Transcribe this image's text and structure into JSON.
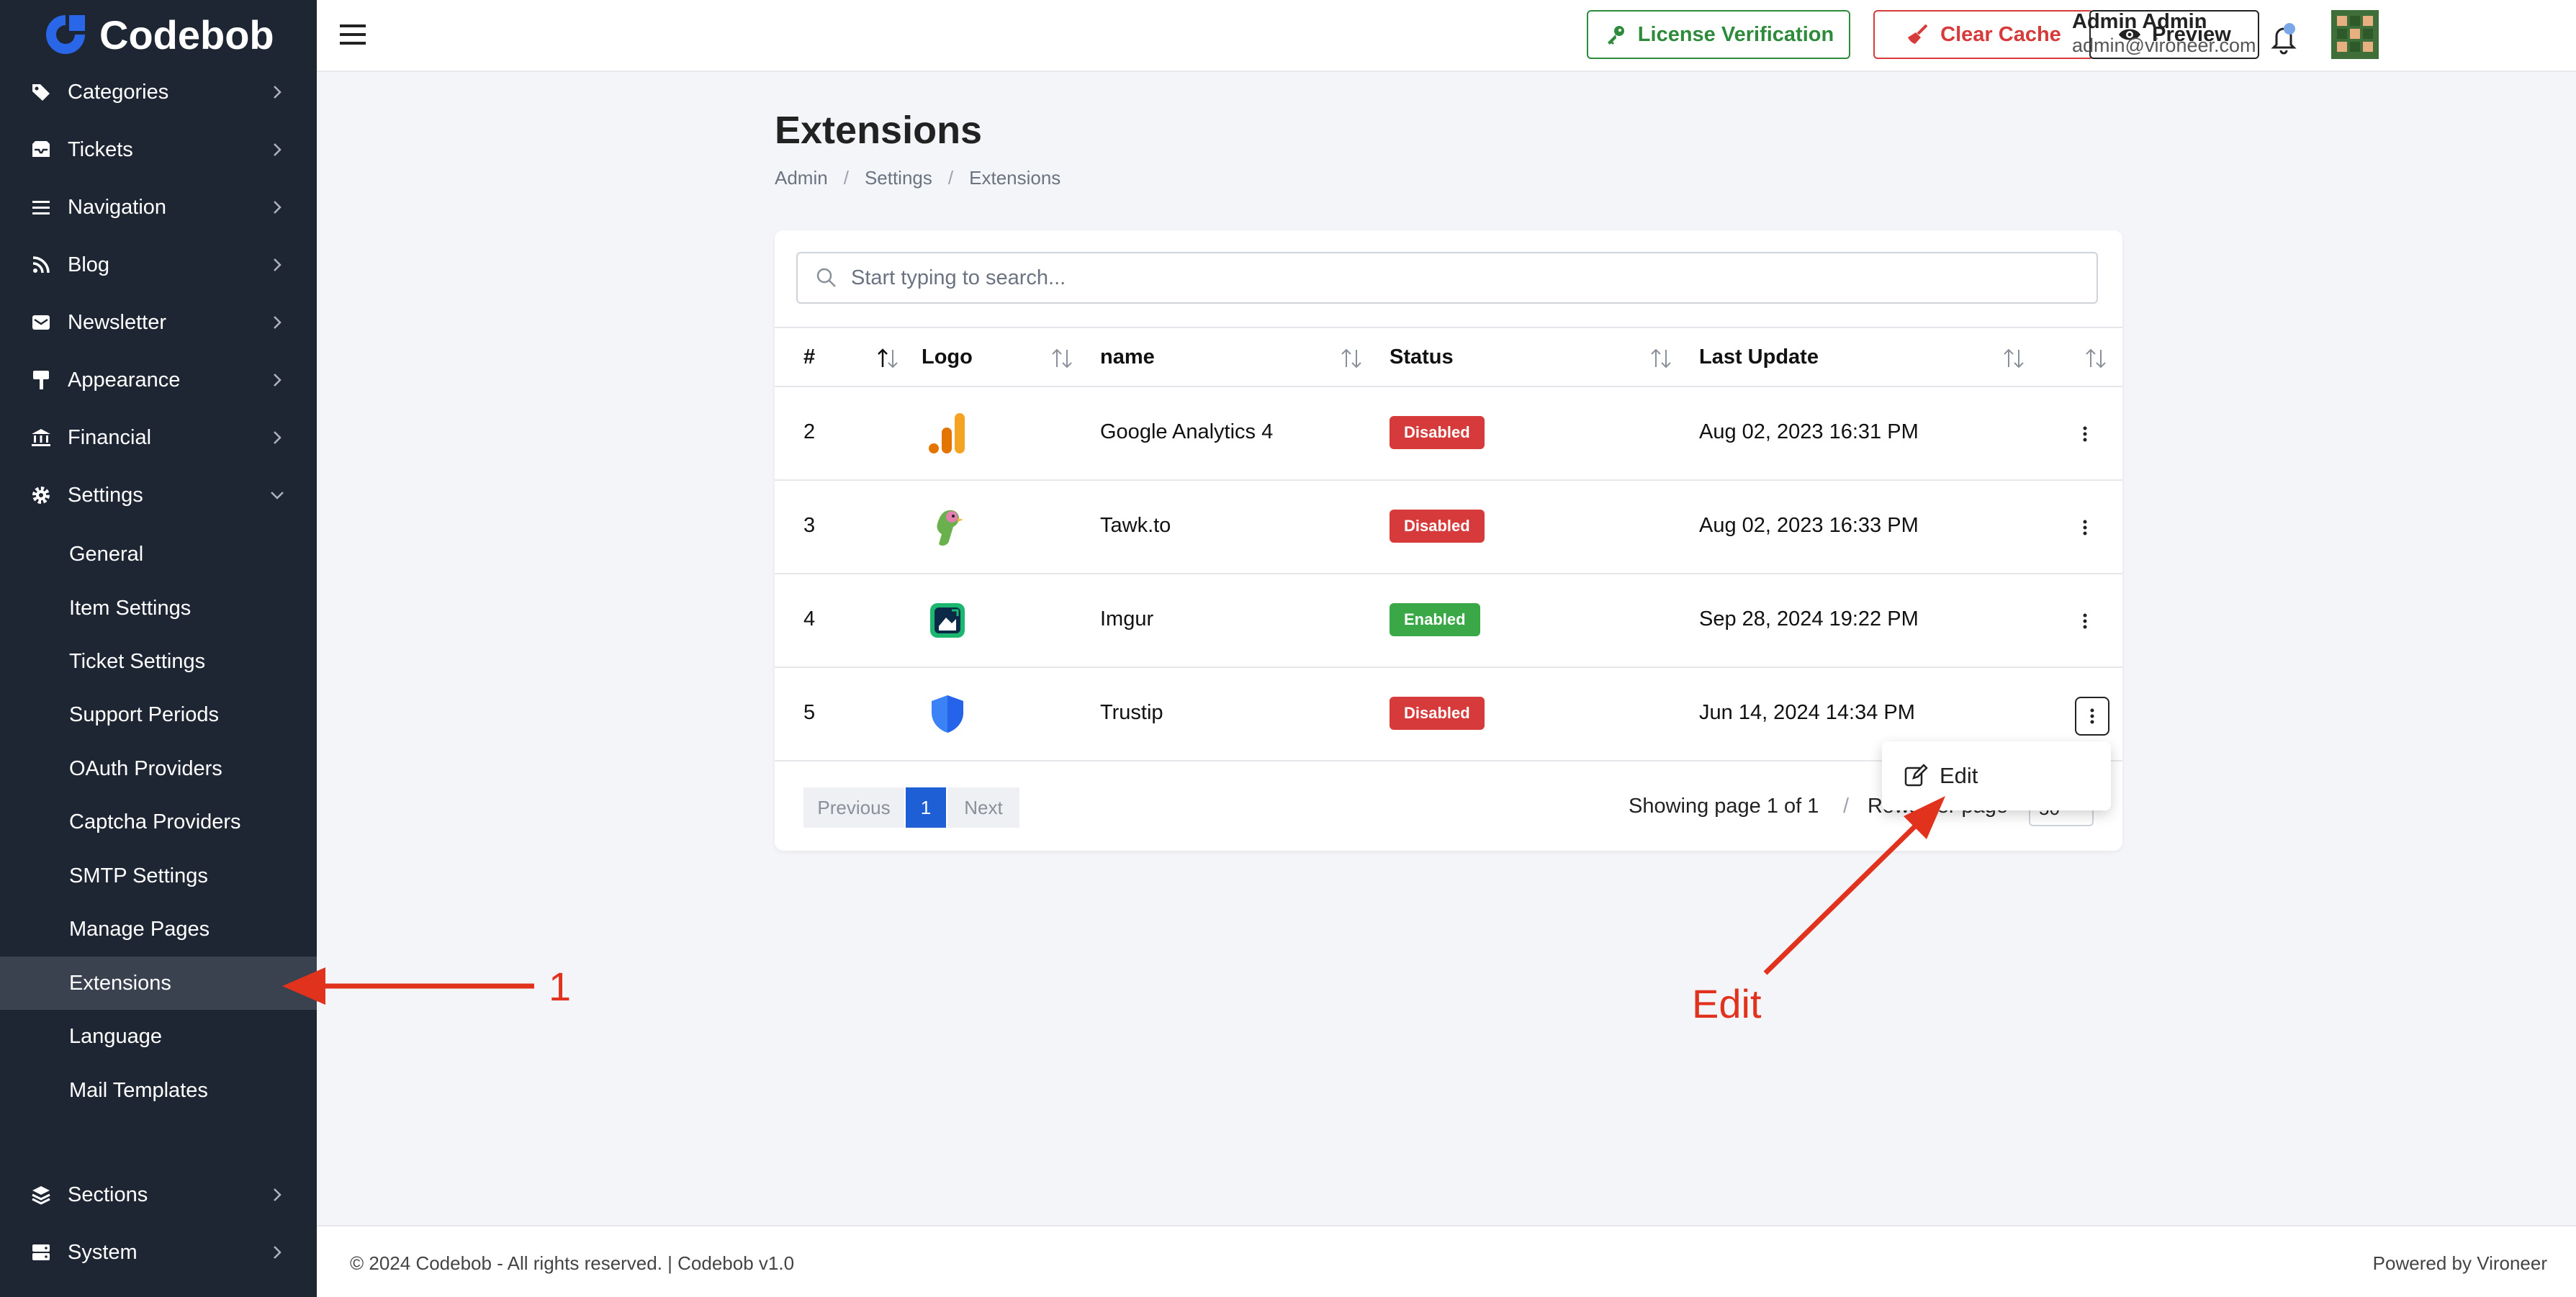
{
  "brand": {
    "name": "Codebob"
  },
  "sidebar": {
    "items": [
      {
        "label": "Categories",
        "icon": "tags-icon"
      },
      {
        "label": "Tickets",
        "icon": "inbox-icon"
      },
      {
        "label": "Navigation",
        "icon": "bars-icon"
      },
      {
        "label": "Blog",
        "icon": "rss-icon"
      },
      {
        "label": "Newsletter",
        "icon": "mail-bulk-icon"
      },
      {
        "label": "Appearance",
        "icon": "paint-roller-icon"
      },
      {
        "label": "Financial",
        "icon": "bank-icon"
      },
      {
        "label": "Settings",
        "icon": "gear-icon"
      }
    ],
    "settings_sub": [
      "General",
      "Item Settings",
      "Ticket Settings",
      "Support Periods",
      "OAuth Providers",
      "Captcha Providers",
      "SMTP Settings",
      "Manage Pages",
      "Extensions",
      "Language",
      "Mail Templates"
    ],
    "active_sub": "Extensions",
    "bottom_items": [
      {
        "label": "Sections",
        "icon": "layers-icon"
      },
      {
        "label": "System",
        "icon": "server-icon"
      }
    ]
  },
  "topbar": {
    "license_label": "License Verification",
    "cache_label": "Clear Cache",
    "preview_label": "Preview",
    "user_name": "Admin Admin",
    "user_email": "admin@vironeer.com"
  },
  "page": {
    "title": "Extensions",
    "breadcrumb": [
      "Admin",
      "Settings",
      "Extensions"
    ]
  },
  "table": {
    "search_placeholder": "Start typing to search...",
    "columns": [
      "#",
      "Logo",
      "name",
      "Status",
      "Last Update"
    ],
    "rows": [
      {
        "id": "2",
        "name": "Google Analytics 4",
        "status": "Disabled",
        "updated": "Aug 02, 2023 16:31 PM",
        "logo": "google-analytics-logo"
      },
      {
        "id": "3",
        "name": "Tawk.to",
        "status": "Disabled",
        "updated": "Aug 02, 2023 16:33 PM",
        "logo": "tawkto-logo"
      },
      {
        "id": "4",
        "name": "Imgur",
        "status": "Enabled",
        "updated": "Sep 28, 2024 19:22 PM",
        "logo": "imgur-logo"
      },
      {
        "id": "5",
        "name": "Trustip",
        "status": "Disabled",
        "updated": "Jun 14, 2024 14:34 PM",
        "logo": "trustip-logo"
      }
    ],
    "pagination": {
      "previous": "Previous",
      "current": "1",
      "next": "Next"
    },
    "showing": "Showing page 1 of 1",
    "rows_per_page_label": "Rows per page",
    "rows_per_page_value": "50"
  },
  "dropdown": {
    "edit_label": "Edit"
  },
  "footer": {
    "left": "© 2024 Codebob - All rights reserved. | Codebob v1.0",
    "right": "Powered by Vironeer"
  },
  "annotations": {
    "label_1": "1",
    "label_edit": "Edit"
  },
  "colors": {
    "sidebar_bg": "#1f2633",
    "disabled": "#d63a3a",
    "enabled": "#3aa846",
    "annotation": "#e1321e",
    "pager_active": "#1f5fd6"
  }
}
